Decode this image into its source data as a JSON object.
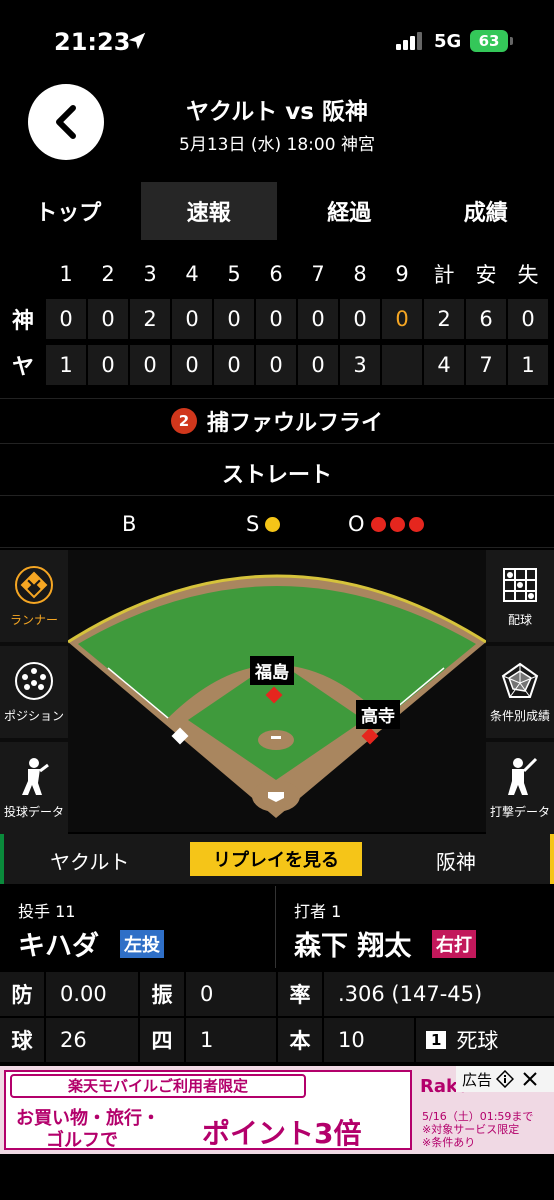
{
  "status": {
    "time": "21:23",
    "network": "5G",
    "battery": "63"
  },
  "header": {
    "title": "ヤクルト vs 阪神",
    "subtitle": "5月13日 (水) 18:00 神宮"
  },
  "tabs": [
    {
      "label": "トップ",
      "active": false
    },
    {
      "label": "速報",
      "active": true
    },
    {
      "label": "経過",
      "active": false
    },
    {
      "label": "成績",
      "active": false
    }
  ],
  "scoreboard": {
    "innings": [
      "1",
      "2",
      "3",
      "4",
      "5",
      "6",
      "7",
      "8",
      "9"
    ],
    "totals_headers": [
      "計",
      "安",
      "失"
    ],
    "rows": [
      {
        "team": "神",
        "scores": [
          "0",
          "0",
          "2",
          "0",
          "0",
          "0",
          "0",
          "0",
          "0"
        ],
        "totals": [
          "2",
          "6",
          "0"
        ]
      },
      {
        "team": "ヤ",
        "scores": [
          "1",
          "0",
          "0",
          "0",
          "0",
          "0",
          "0",
          "3",
          ""
        ],
        "totals": [
          "4",
          "7",
          "1"
        ]
      }
    ],
    "highlight_color": "#f5a623"
  },
  "play": {
    "number": "2",
    "result": "捕ファウルフライ",
    "pitch_type": "ストレート"
  },
  "count": {
    "b_label": "B",
    "s_label": "S",
    "o_label": "O",
    "balls": 0,
    "strikes": 1,
    "outs": 3
  },
  "field": {
    "side_left": [
      {
        "label": "ランナー",
        "icon": "runner-diamond-icon",
        "active": true
      },
      {
        "label": "ポジション",
        "icon": "position-dots-icon",
        "active": false
      },
      {
        "label": "投球データ",
        "icon": "pitcher-icon",
        "active": false
      }
    ],
    "side_right": [
      {
        "label": "配球",
        "icon": "pitch-grid-icon",
        "active": false
      },
      {
        "label": "条件別成績",
        "icon": "radar-chart-icon",
        "active": false
      },
      {
        "label": "打撃データ",
        "icon": "batter-icon",
        "active": false
      }
    ],
    "runners": {
      "second": "福島",
      "first": "高寺"
    }
  },
  "team_bar": {
    "home": "ヤクルト",
    "replay": "リプレイを見る",
    "away": "阪神"
  },
  "pitcher": {
    "role": "投手 11",
    "name": "キハダ",
    "hand": "左投",
    "hand_color": "#2f6fc7"
  },
  "batter": {
    "role": "打者 1",
    "name": "森下 翔太",
    "hand": "右打",
    "hand_color": "#c2185b"
  },
  "stats": {
    "r1": [
      [
        "防",
        "0.00"
      ],
      [
        "振",
        "0"
      ],
      [
        "率",
        ".306 (147-45)"
      ]
    ],
    "r2": [
      [
        "球",
        "26"
      ],
      [
        "四",
        "1"
      ],
      [
        "本",
        "10"
      ]
    ],
    "history": {
      "num": "1",
      "text": "死球"
    }
  },
  "ad": {
    "top": "楽天モバイルご利用者限定",
    "line1": "お買い物・旅行・",
    "line2": "ゴルフで",
    "big": "ポイント3倍",
    "brand": "Raku",
    "note1": "5/16（土）01:59まで",
    "note2": "※対象サービス限定",
    "note3": "※条件あり",
    "label": "広告"
  }
}
